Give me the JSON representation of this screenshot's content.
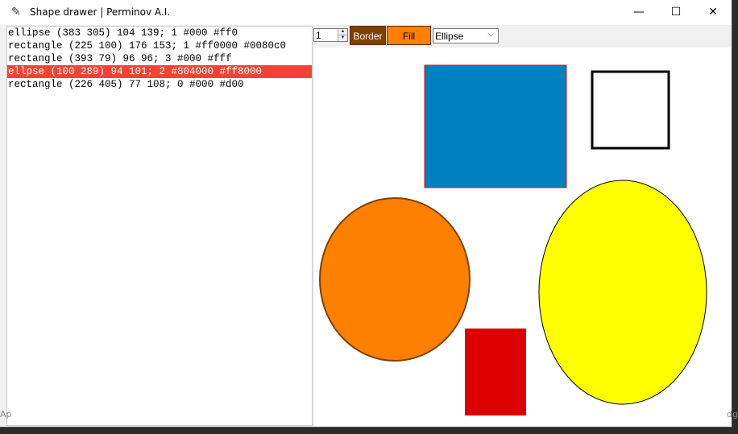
{
  "window": {
    "title": "Shape drawer | Perminov A.I.",
    "icon": "feather-icon",
    "minimize_glyph": "—",
    "maximize_glyph": "☐",
    "close_glyph": "✕"
  },
  "shape_list": {
    "items": [
      {
        "text": "ellipse (383 305) 104 139; 1 #000 #ff0",
        "selected": false
      },
      {
        "text": "rectangle (225 100) 176 153; 1 #ff0000 #0080c0",
        "selected": false
      },
      {
        "text": "rectangle (393 79) 96 96; 3 #000 #fff",
        "selected": false
      },
      {
        "text": "ellpse (100 289) 94 101; 2 #804000 #ff8000",
        "selected": true
      },
      {
        "text": "rectangle (226 405) 77 108; 0 #000 #d00",
        "selected": false
      }
    ]
  },
  "toolbar": {
    "border_width": "1",
    "border_label": "Border",
    "border_color": "#804000",
    "fill_label": "Fill",
    "fill_color": "#ff8000",
    "shape_select": "Ellipse"
  },
  "background": {
    "left_fragment": "Ap",
    "right_fragment": "dg"
  }
}
